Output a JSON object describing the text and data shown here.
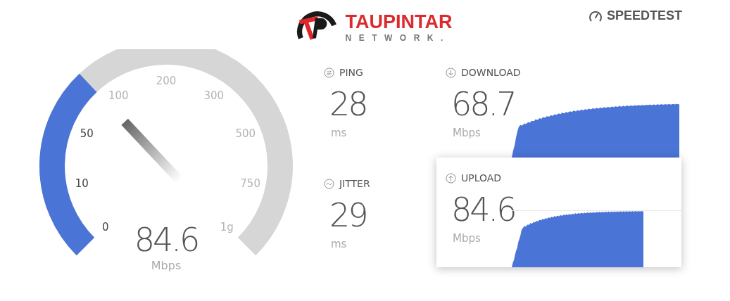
{
  "header": {
    "logo_name": "TAUPINTAR",
    "logo_tagline": "NETWORK.",
    "brand": "SPEEDTEST"
  },
  "gauge": {
    "value": "84.6",
    "unit": "Mbps",
    "ticks": [
      {
        "label": "0",
        "reached": true
      },
      {
        "label": "10",
        "reached": true
      },
      {
        "label": "50",
        "reached": true
      },
      {
        "label": "100",
        "reached": false
      },
      {
        "label": "200",
        "reached": false
      },
      {
        "label": "300",
        "reached": false
      },
      {
        "label": "500",
        "reached": false
      },
      {
        "label": "750",
        "reached": false
      },
      {
        "label": "1g",
        "reached": false
      }
    ]
  },
  "metrics": [
    {
      "kind": "ping",
      "label": "PING",
      "value": "28",
      "unit": "ms"
    },
    {
      "kind": "jitter",
      "label": "JITTER",
      "value": "29",
      "unit": "ms"
    }
  ],
  "results": [
    {
      "kind": "download",
      "label": "DOWNLOAD",
      "value": "68.7",
      "unit": "Mbps",
      "selected": false
    },
    {
      "kind": "upload",
      "label": "UPLOAD",
      "value": "84.6",
      "unit": "Mbps",
      "selected": true
    }
  ]
}
